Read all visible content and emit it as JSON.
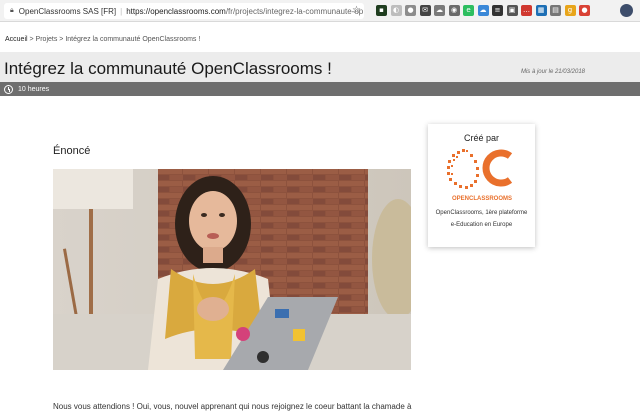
{
  "browser": {
    "site": "OpenClassrooms SAS [FR]",
    "url_host": "https://openclassrooms.com",
    "url_path": "/fr/projects/integrez-la-communaute-op...",
    "extensions": [
      {
        "name": "terminal-ext-icon",
        "color": "#1f3d1f",
        "glyph": "▪"
      },
      {
        "name": "ghost-ext-icon",
        "color": "#bdbdbd",
        "glyph": "◐"
      },
      {
        "name": "chat-ext-icon",
        "color": "#8c8c8c",
        "glyph": "●"
      },
      {
        "name": "mail-ext-icon",
        "color": "#444444",
        "glyph": "✉"
      },
      {
        "name": "cloud-ext-icon",
        "color": "#7a7a7a",
        "glyph": "☁"
      },
      {
        "name": "ublock-ext-icon",
        "color": "#6b6b6b",
        "glyph": "◉"
      },
      {
        "name": "evernote-ext-icon",
        "color": "#2dbe60",
        "glyph": "e"
      },
      {
        "name": "onedrive-ext-icon",
        "color": "#3a88d8",
        "glyph": "☁"
      },
      {
        "name": "dark-ext-icon",
        "color": "#333333",
        "glyph": "≡"
      },
      {
        "name": "save-ext-icon",
        "color": "#555555",
        "glyph": "▣"
      },
      {
        "name": "lastpass-ext-icon",
        "color": "#d0382f",
        "glyph": "…"
      },
      {
        "name": "dashlane-ext-icon",
        "color": "#1d6fb5",
        "glyph": "▦"
      },
      {
        "name": "grid-ext-icon",
        "color": "#777777",
        "glyph": "▤"
      },
      {
        "name": "google-ext-icon",
        "color": "#e8a51a",
        "glyph": "g"
      },
      {
        "name": "hangouts-ext-icon",
        "color": "#d94235",
        "glyph": "●"
      }
    ]
  },
  "breadcrumb": {
    "home": "Accueil",
    "rest": " > Projets > Intégrez la communauté OpenClassrooms !"
  },
  "header": {
    "title": "Intégrez la communauté OpenClassrooms !",
    "updated": "Mis à jour le 21/03/2018",
    "duration": "10 heures"
  },
  "main": {
    "section_title": "Énoncé",
    "intro": "Nous vous attendions ! Oui, vous, nouvel apprenant qui nous rejoignez le coeur battant la chamade à"
  },
  "card": {
    "by": "Créé par",
    "logo_text": "OPENCLASSROOMS",
    "desc_line1": "OpenClassrooms, 1ère plateforme",
    "desc_line2": "e-Education en Europe"
  },
  "colors": {
    "brand_orange": "#e9702c",
    "duration_bar": "#6e6e6e"
  }
}
